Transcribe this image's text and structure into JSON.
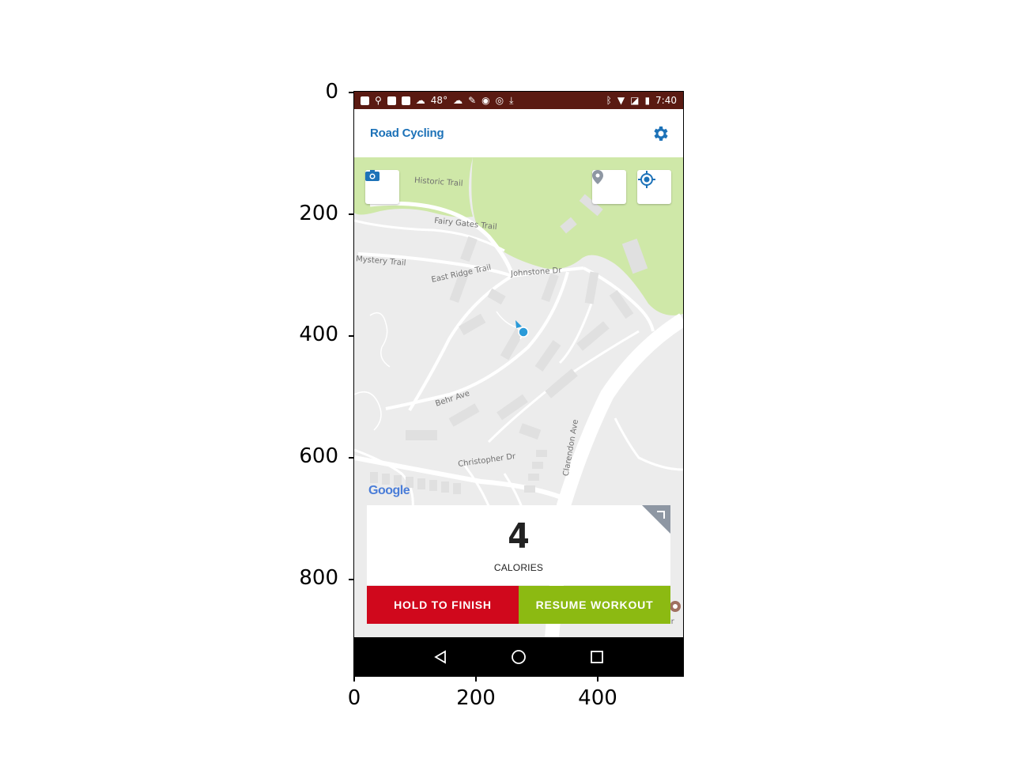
{
  "axes": {
    "y_ticks": [
      "0",
      "200",
      "400",
      "600",
      "800"
    ],
    "x_ticks": [
      "0",
      "200",
      "400"
    ]
  },
  "status_bar": {
    "temperature": "48°",
    "time": "7:40"
  },
  "app_bar": {
    "title": "Road Cycling"
  },
  "map": {
    "labels": {
      "historic_trail": "Historic Trail",
      "fairy_gates_trail": "Fairy Gates Trail",
      "mystery_trail": "Mystery Trail",
      "east_ridge_trail": "East Ridge Trail",
      "johnstone_dr": "Johnstone Dr",
      "behr_ave": "Behr Ave",
      "christopher_dr": "Christopher Dr",
      "clarendon_ave": "Clarendon Ave",
      "sutro_tower": "Sutro Tower"
    },
    "attribution": "Google",
    "colors": {
      "park": "#cfe8a8",
      "road": "#ffffff",
      "land": "#ececec",
      "location": "#2a9ad8"
    }
  },
  "stats_card": {
    "value": "4",
    "label": "CALORIES"
  },
  "actions": {
    "finish_label": "HOLD TO FINISH",
    "resume_label": "RESUME WORKOUT",
    "finish_color": "#d0081c",
    "resume_color": "#8cba12"
  },
  "icons": {
    "settings": "gear-icon",
    "camera": "camera-icon",
    "pin": "map-pin-icon",
    "locate": "my-location-icon",
    "back": "back-icon",
    "home": "home-icon",
    "recents": "recents-icon"
  }
}
